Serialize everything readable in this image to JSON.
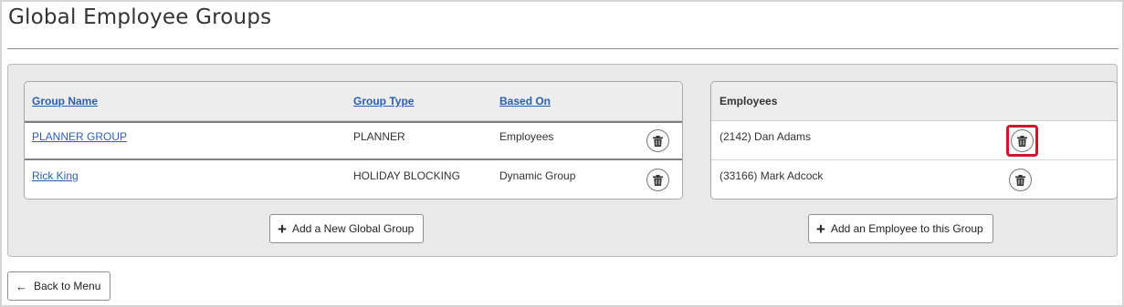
{
  "page": {
    "title": "Global Employee Groups"
  },
  "groups_table": {
    "headers": {
      "group_name": "Group Name",
      "group_type": "Group Type",
      "based_on": "Based On"
    },
    "rows": [
      {
        "name": "PLANNER GROUP",
        "type": "PLANNER",
        "based_on": "Employees",
        "selected": true
      },
      {
        "name": "Rick King",
        "type": "HOLIDAY BLOCKING",
        "based_on": "Dynamic Group",
        "selected": false
      }
    ],
    "add_button_label": "Add a New Global Group"
  },
  "employees_table": {
    "header": "Employees",
    "rows": [
      {
        "label": "(2142) Dan Adams"
      },
      {
        "label": "(33166) Mark Adcock"
      }
    ],
    "add_button_label": "Add an Employee to this Group"
  },
  "footer": {
    "back_label": "Back to Menu"
  },
  "colors": {
    "link": "#2e5fa8",
    "highlight": "#d0142c",
    "panel_bg": "#e9e9ea"
  },
  "icons": {
    "delete": "trash-icon",
    "add": "plus-icon",
    "back": "arrow-left-icon"
  }
}
